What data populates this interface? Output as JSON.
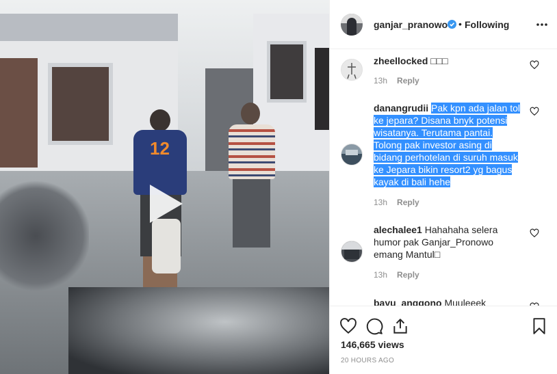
{
  "post": {
    "username": "ganjar_pranowo",
    "dot": "•",
    "follow_status": "Following",
    "views": "146,665 views",
    "time": "20 HOURS AGO"
  },
  "comments": [
    {
      "user": "zheellocked",
      "text": "□□□",
      "text_highlight": "",
      "time": "13h",
      "reply": "Reply"
    },
    {
      "user": "danangrudii",
      "text": "",
      "text_highlight": "Pak kpn ada jalan tol ke jepara? Disana bnyk potensi wisatanya. Terutama pantai. Tolong pak investor asing di bidang perhotelan di suruh masuk ke Jepara bikin resort2 yg bagus kayak di bali hehe",
      "time": "13h",
      "reply": "Reply"
    },
    {
      "user": "alechalee1",
      "text": "Hahahaha selera humor pak Ganjar_Pronowo emang Mantul□",
      "text_highlight": "",
      "time": "13h",
      "reply": "Reply"
    },
    {
      "user": "bayu_anggono",
      "text": "Muuleeek",
      "text_highlight": "",
      "time": "",
      "reply": ""
    }
  ],
  "media": {
    "jersey_number": "12"
  },
  "icons": [
    "play-icon",
    "verified-icon",
    "more-icon",
    "heart-icon",
    "comment-icon",
    "share-icon",
    "bookmark-icon"
  ],
  "colors": {
    "highlight": "#3390ff",
    "verified": "#3897f0",
    "muted": "#8e8e8e",
    "text": "#262626"
  }
}
